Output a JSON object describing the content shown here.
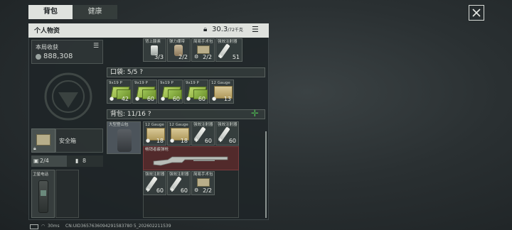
{
  "tabs": [
    {
      "label": "背包"
    },
    {
      "label": "健康"
    }
  ],
  "header": {
    "title": "个人物资",
    "weight": "30.3",
    "weight_max": "/72千克"
  },
  "left": {
    "earnings_label": "本局收获",
    "earnings_value": "888,308",
    "safe_box_label": "安全箱",
    "counter_a": "2/4",
    "counter_b": "8",
    "phone_label": "卫星电话"
  },
  "top_items": [
    {
      "label": "肾上腺素",
      "count": "3/3"
    },
    {
      "label": "弹力绷带",
      "count": "2/2"
    },
    {
      "label": "简易手术包",
      "count": "2/2"
    },
    {
      "label": "强效注射器",
      "count": "51"
    }
  ],
  "pocket": {
    "title": "口袋: 5/5",
    "help": "?",
    "items": [
      {
        "label": "9x19 P",
        "count": "42"
      },
      {
        "label": "9x19 P",
        "count": "60"
      },
      {
        "label": "9x19 P",
        "count": "60"
      },
      {
        "label": "9x19 P",
        "count": "60"
      },
      {
        "label": "12 Gauge",
        "count": "13"
      }
    ]
  },
  "backpack": {
    "title": "背包: 11/16",
    "help": "?",
    "bag_label": "大型登山包",
    "row1": [
      {
        "label": "12 Gauge",
        "count": "18"
      },
      {
        "label": "12 Gauge",
        "count": "18"
      },
      {
        "label": "强效注射器",
        "count": "60"
      },
      {
        "label": "强效注射器",
        "count": "60"
      }
    ],
    "weapon_label": "畅销者霰弹枪",
    "row3": [
      {
        "label": "强效注射器",
        "count": "60"
      },
      {
        "label": "强效注射器",
        "count": "60"
      },
      {
        "label": "简易手术包",
        "count": "2/2"
      }
    ]
  },
  "status": {
    "ping": "30ms",
    "uid": "CN:UID3657636094291583780 5_202602211539"
  },
  "colors": {
    "panel_header": "#dfe2de",
    "weapon_bg": "#5a2a2c",
    "accent_green": "#4caf50"
  }
}
